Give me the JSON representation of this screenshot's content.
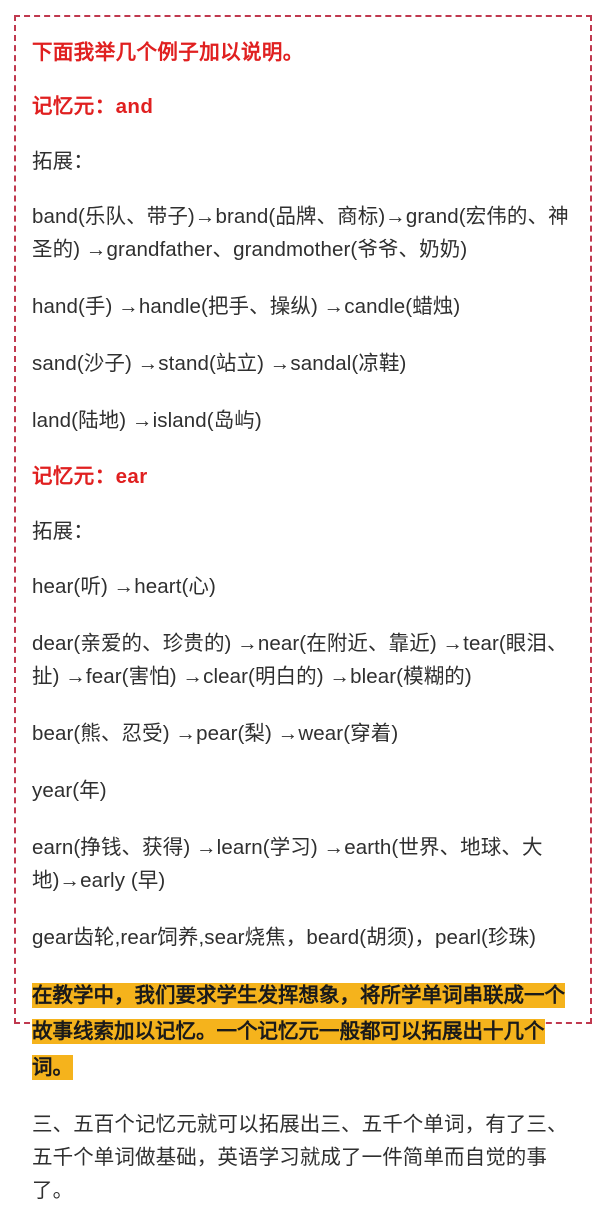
{
  "document": {
    "frame": {
      "border_style": "dashed",
      "border_color": "#c0394f"
    },
    "colors": {
      "heading_red": "#e02020",
      "body_text": "#2f2f2f",
      "highlight_background": "#f5b31c",
      "highlight_text": "#1a1a1a",
      "page_background": "#ffffff"
    },
    "intro_heading": "下面我举几个例子加以说明。",
    "sections": [
      {
        "heading": "记忆元：and",
        "expand_label": "拓展：",
        "lines": [
          "band(乐队、带子)→brand(品牌、商标)→grand(宏伟的、神圣的) →grandfather、grandmother(爷爷、奶奶)",
          "hand(手) →handle(把手、操纵) →candle(蜡烛)",
          "sand(沙子) →stand(站立) →sandal(凉鞋)",
          "land(陆地) →island(岛屿)"
        ]
      },
      {
        "heading": "记忆元：ear",
        "expand_label": "拓展：",
        "lines": [
          "hear(听) →heart(心)",
          "dear(亲爱的、珍贵的) →near(在附近、靠近) →tear(眼泪、扯) →fear(害怕) →clear(明白的) →blear(模糊的)",
          "bear(熊、忍受) →pear(梨) →wear(穿着)",
          "year(年)",
          "earn(挣钱、获得) →learn(学习) →earth(世界、地球、大地)→early (早)",
          "gear齿轮,rear饲养,sear烧焦，beard(胡须)，pearl(珍珠)"
        ]
      }
    ],
    "highlighted_note": "在教学中，我们要求学生发挥想象，将所学单词串联成一个故事线索加以记忆。一个记忆元一般都可以拓展出十几个词。",
    "closing_paragraph": "三、五百个记忆元就可以拓展出三、五千个单词，有了三、五千个单词做基础，英语学习就成了一件简单而自觉的事了。"
  }
}
